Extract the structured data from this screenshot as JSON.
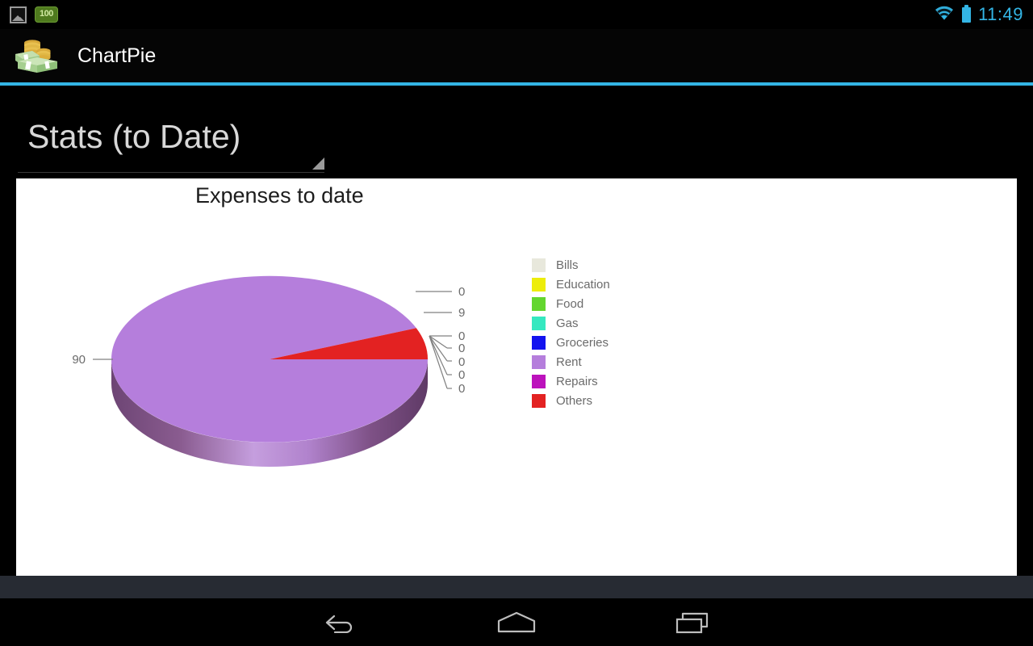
{
  "status_bar": {
    "left_icons": [
      "screenshot-icon",
      "battery-percent-badge"
    ],
    "battery_badge": "100",
    "right_icons": [
      "wifi-icon",
      "battery-icon"
    ],
    "clock": "11:49",
    "accent_color": "#33b5e5"
  },
  "action_bar": {
    "app_icon": "money-stack-icon",
    "title": "ChartPie"
  },
  "spinner": {
    "selected": "Stats (to Date)",
    "caret_icon": "dropdown-triangle-icon"
  },
  "legend": {
    "items": [
      {
        "label": "Bills",
        "color": "#e8e8dc"
      },
      {
        "label": "Education",
        "color": "#eded0a"
      },
      {
        "label": "Food",
        "color": "#63d62e"
      },
      {
        "label": "Gas",
        "color": "#35e8c0"
      },
      {
        "label": "Groceries",
        "color": "#1313ef"
      },
      {
        "label": "Rent",
        "color": "#b57edc"
      },
      {
        "label": "Repairs",
        "color": "#bc12bc"
      },
      {
        "label": "Others",
        "color": "#e32222"
      }
    ]
  },
  "chart_data": {
    "type": "pie",
    "title": "Expenses to date",
    "categories": [
      "Bills",
      "Education",
      "Food",
      "Gas",
      "Groceries",
      "Rent",
      "Repairs",
      "Others"
    ],
    "values": [
      0,
      0,
      0,
      0,
      0,
      90,
      0,
      9
    ],
    "data_labels": [
      "0",
      "0",
      "0",
      "0",
      "0",
      "90",
      "0",
      "9"
    ],
    "colors": [
      "#e8e8dc",
      "#eded0a",
      "#63d62e",
      "#35e8c0",
      "#1313ef",
      "#b57edc",
      "#bc12bc",
      "#e32222"
    ],
    "legend_position": "right",
    "grid": false,
    "three_d": true,
    "label_color": "#6b6b6b",
    "background": "#ffffff",
    "visible_label_texts": {
      "left": "90",
      "right_top": "0",
      "right_second": "9",
      "right_fan": [
        "0",
        "0",
        "0",
        "0",
        "0"
      ]
    }
  },
  "nav_bar": {
    "buttons": [
      {
        "name": "back-button",
        "icon": "back-arrow-icon"
      },
      {
        "name": "home-button",
        "icon": "home-icon"
      },
      {
        "name": "recents-button",
        "icon": "recents-icon"
      }
    ]
  }
}
